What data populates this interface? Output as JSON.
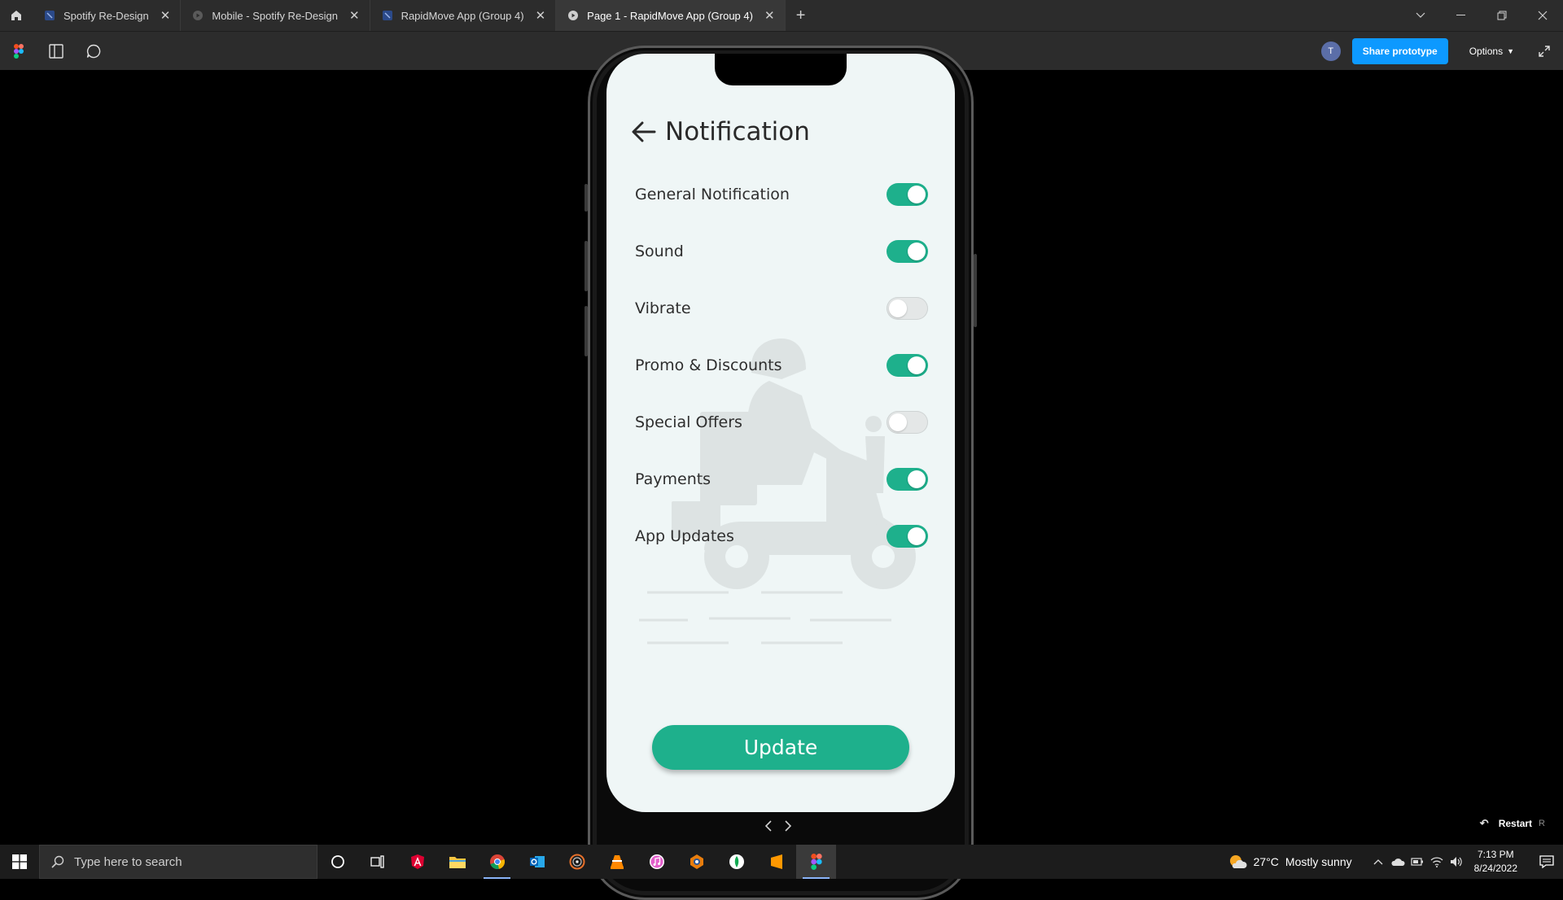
{
  "tabs": [
    {
      "label": "Spotify Re-Design",
      "icon": "figma-file-icon",
      "active": false
    },
    {
      "label": "Mobile - Spotify Re-Design",
      "icon": "prototype-play-icon",
      "active": false
    },
    {
      "label": "RapidMove App (Group 4)",
      "icon": "figma-file-icon",
      "active": false
    },
    {
      "label": "Page 1 - RapidMove App (Group 4)",
      "icon": "prototype-play-icon",
      "active": true
    }
  ],
  "toolbar": {
    "doc_title": "RapidMove App (Group 4)",
    "avatar_initial": "T",
    "share_label": "Share prototype",
    "options_label": "Options"
  },
  "screen": {
    "title": "Notification",
    "settings": [
      {
        "label": "General Notification",
        "on": true
      },
      {
        "label": "Sound",
        "on": true
      },
      {
        "label": "Vibrate",
        "on": false
      },
      {
        "label": "Promo & Discounts",
        "on": true
      },
      {
        "label": "Special Offers",
        "on": false
      },
      {
        "label": "Payments",
        "on": true
      },
      {
        "label": "App Updates",
        "on": true
      }
    ],
    "update_label": "Update"
  },
  "player": {
    "restart_label": "Restart",
    "restart_key": "R"
  },
  "taskbar": {
    "search_placeholder": "Type here to search",
    "apps": [
      "cortana-icon",
      "task-view-icon",
      "angular-icon",
      "file-explorer-icon",
      "chrome-icon",
      "outlook-icon",
      "media-player-icon",
      "vlc-icon",
      "itunes-icon",
      "blender-icon",
      "mongodb-icon",
      "sublime-text-icon",
      "figma-icon"
    ],
    "weather_temp": "27°C",
    "weather_text": "Mostly sunny",
    "time": "7:13 PM",
    "date": "8/24/2022"
  },
  "colors": {
    "accent_green": "#1eb08c",
    "figma_blue": "#0d99ff",
    "screen_bg": "#eff6f6"
  }
}
